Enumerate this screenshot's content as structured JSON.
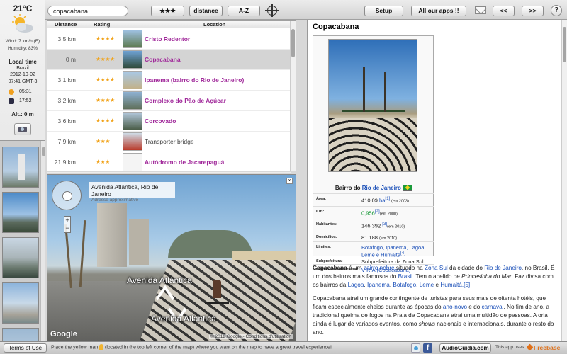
{
  "weather": {
    "temperature": "21°C",
    "icon": "partly-cloudy-icon",
    "wind": "Wind: 7 km/h (E)",
    "humidity": "Humidity: 83%",
    "local_time_title": "Local time",
    "country": "Brazil",
    "date": "2012-10-02",
    "clock": "07:41 GMT-3",
    "sunrise": "05:31",
    "sunset": "17:52",
    "altitude": "Alt.: 0 m"
  },
  "toolbar": {
    "search_value": "copacabana",
    "sort_rating_label": "★★★",
    "sort_distance_label": "distance",
    "sort_az_label": "A-Z",
    "setup_label": "Setup",
    "apps_label": "All our apps !!",
    "prev_label": "<<",
    "next_label": ">>",
    "help_label": "?"
  },
  "list": {
    "headers": {
      "distance": "Distance",
      "rating": "Rating",
      "location": "Location"
    },
    "rows": [
      {
        "distance": "3.5 km",
        "stars": "★★★★",
        "name": "Cristo Redentor",
        "linked": true,
        "selected": false
      },
      {
        "distance": "0 m",
        "stars": "★★★★",
        "name": "Copacabana",
        "linked": true,
        "selected": true
      },
      {
        "distance": "3.1 km",
        "stars": "★★★★",
        "name": "Ipanema (bairro do Rio de Janeiro)",
        "linked": true,
        "selected": false
      },
      {
        "distance": "3.2 km",
        "stars": "★★★★",
        "name": "Complexo do Pão de Açúcar",
        "linked": true,
        "selected": false
      },
      {
        "distance": "3.6 km",
        "stars": "★★★★",
        "name": "Corcovado",
        "linked": true,
        "selected": false
      },
      {
        "distance": "7.9 km",
        "stars": "★★★",
        "name": "Transporter bridge",
        "linked": false,
        "selected": false
      },
      {
        "distance": "21.9 km",
        "stars": "★★★",
        "name": "Autódromo de Jacarepaguá",
        "linked": true,
        "selected": false
      }
    ]
  },
  "map": {
    "label_title": "Avenida Atlântica, Rio de Janeiro",
    "label_sub": "Adresse approximative",
    "street_name_1": "Avenida Atlântica",
    "street_name_2": "Avenida Atlântica",
    "google": "Google",
    "copyright": "© 2012 Google - Conditions d'utilisation",
    "zoom_in": "+",
    "zoom_out": "−",
    "close": "×"
  },
  "article": {
    "title": "Copacabana",
    "caption_prefix": "Bairro do ",
    "caption_link": "Rio de Janeiro",
    "infobox": [
      {
        "key": "Área:",
        "value": "410,09 ",
        "link": "ha",
        "small": " (em 2003)",
        "sup": "[1]"
      },
      {
        "key": "IDH:",
        "value": "",
        "green": "0,956",
        "sup": "[2]",
        "small": "(em 2000)"
      },
      {
        "key": "Habitantes:",
        "value": "146 392 ",
        "small": "(em 2010)",
        "sup": "[3]"
      },
      {
        "key": "Domicílios:",
        "value": "81 188 ",
        "small": "(em 2010)"
      },
      {
        "key": "Limites:",
        "links": "Botafogo, Ipanema, Lagoa, Leme e Humaitá",
        "sup": "[4]"
      },
      {
        "key": "Subprefeitura:",
        "value": "Subprefeitura da Zona Sul"
      },
      {
        "key": "Região Administrativa:",
        "links": "V R.A.(Copacabana)"
      }
    ],
    "paragraph1_parts": [
      {
        "t": "Copacabana",
        "b": true
      },
      {
        "t": " é um "
      },
      {
        "t": "bairro nobre",
        "l": true
      },
      {
        "t": " situado na "
      },
      {
        "t": "Zona Sul",
        "l": true
      },
      {
        "t": " da cidade do "
      },
      {
        "t": "Rio de Janeiro",
        "l": true
      },
      {
        "t": ", no Brasil. É um dos bairros mais famosos do "
      },
      {
        "t": "Brasil",
        "l": true
      },
      {
        "t": ". Tem o apelido de "
      },
      {
        "t": "Princesinha do Mar",
        "i": true
      },
      {
        "t": ". Faz divisa com os bairros da "
      },
      {
        "t": "Lagoa",
        "l": true
      },
      {
        "t": ", "
      },
      {
        "t": "Ipanema",
        "l": true
      },
      {
        "t": ", "
      },
      {
        "t": "Botafogo",
        "l": true
      },
      {
        "t": ", "
      },
      {
        "t": "Leme",
        "l": true
      },
      {
        "t": " e "
      },
      {
        "t": "Humaitá",
        "l": true
      },
      {
        "t": ".[5]",
        "l": true
      }
    ],
    "paragraph2_parts": [
      {
        "t": "Copacabana atrai um grande contingente de turistas para seus mais de oitenta hotéis, que ficam especialmente cheios durante as épocas do "
      },
      {
        "t": "ano-novo",
        "l": true
      },
      {
        "t": " e do "
      },
      {
        "t": "carnaval",
        "l": true
      },
      {
        "t": ". No fim de ano, a tradicional queima de fogos na Praia de Copacabana atrai uma multidão de pessoas. A orla ainda é lugar de variados eventos, como "
      },
      {
        "t": "shows",
        "i": true
      },
      {
        "t": " nacionais e internacionais, durante o resto do ano."
      }
    ]
  },
  "bottom": {
    "terms_label": "Terms of Use",
    "hint_before": "Place the yellow man ",
    "hint_after": " (located in the top left corner of the map) where you want on the map to have a great travel experience!",
    "audioguidia_label": "AudioGuidia.com",
    "app_uses": "This app uses",
    "freebase": "Freebase"
  },
  "colors": {
    "link": "#1a4fb8",
    "list_link": "#a0289a",
    "stars": "#f1a31a",
    "selected_row": "#d4d4d4"
  }
}
